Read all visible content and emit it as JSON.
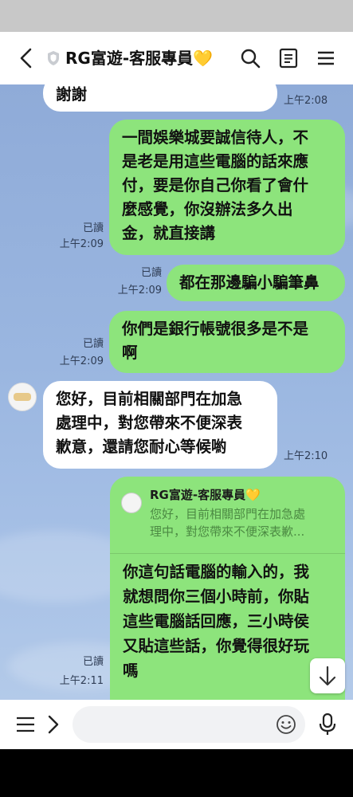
{
  "header": {
    "title": "RG富遊-客服專員💛"
  },
  "messages": [
    {
      "id": "m0",
      "side": "recv",
      "lines": [
        "謝謝"
      ],
      "time": "上午2:08"
    },
    {
      "id": "m1",
      "side": "sent",
      "lines": [
        "一間娛樂城要誠信待人，不",
        "是老是用這些電腦的話來應",
        "付，要是你自己你看了會什",
        "麼感覺，你沒辦法多久出",
        "金，就直接講"
      ],
      "read": "已讀",
      "time": "上午2:09"
    },
    {
      "id": "m2",
      "side": "sent",
      "lines": [
        "都在那邊騙小騙筆鼻"
      ],
      "read": "已讀",
      "time": "上午2:09"
    },
    {
      "id": "m3",
      "side": "sent",
      "lines": [
        "你們是銀行帳號很多是不是",
        "啊"
      ],
      "read": "已讀",
      "time": "上午2:09"
    },
    {
      "id": "m4",
      "side": "recv",
      "lines": [
        "您好，目前相關部門在加急",
        "處理中，對您帶來不便深表",
        "歉意，還請您耐心等候喲"
      ],
      "time": "上午2:10"
    },
    {
      "id": "m5",
      "side": "sent",
      "quote": {
        "name": "RG富遊-客服專員💛",
        "lines": [
          "您好，目前相關部門在加急處",
          "理中，對您帶來不便深表歉..."
        ]
      },
      "lines": [
        "你這句話電腦的輸入的，我",
        "就想問你三個小時前，你貼",
        "這些電腦話回應，三小時侯",
        "又貼這些話，你覺得很好玩",
        "嗎"
      ],
      "read": "已讀",
      "time": "上午2:11"
    }
  ],
  "input": {
    "placeholder": ""
  },
  "icons": {
    "back": "chevron-left-icon",
    "shield": "shield-icon",
    "search": "search-icon",
    "notes": "notes-icon",
    "menu": "hamburger-menu-icon",
    "scroll_down": "arrow-down-icon",
    "emoji": "emoji-icon",
    "mic": "microphone-icon"
  },
  "colors": {
    "sent_bubble": "#8de47c",
    "recv_bubble": "#ffffff",
    "chat_bg": "#9ab6e0",
    "quote_text": "#4c8a43"
  }
}
